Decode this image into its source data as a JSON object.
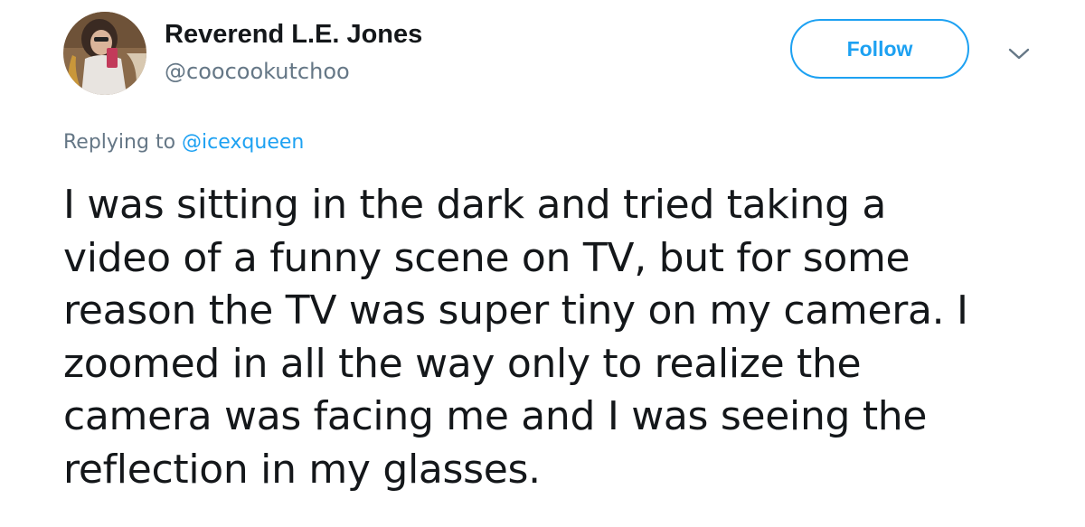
{
  "tweet": {
    "author": {
      "display_name": "Reverend L.E. Jones",
      "handle": "@coocookutchoo",
      "avatar_icon": "user-avatar"
    },
    "follow_label": "Follow",
    "menu_icon": "chevron-down-icon",
    "replying_prefix": "Replying to",
    "replying_to": "@icexqueen",
    "text": "I was sitting in the dark and tried taking a\nvideo of a funny scene on TV, but for some\nreason the TV was super tiny on my camera. I\nzoomed in all the way only to realize the\ncamera was facing me and I was seeing the\nreflection in my glasses."
  },
  "colors": {
    "accent": "#1da1f2",
    "secondary_text": "#657786",
    "primary_text": "#14171a"
  }
}
